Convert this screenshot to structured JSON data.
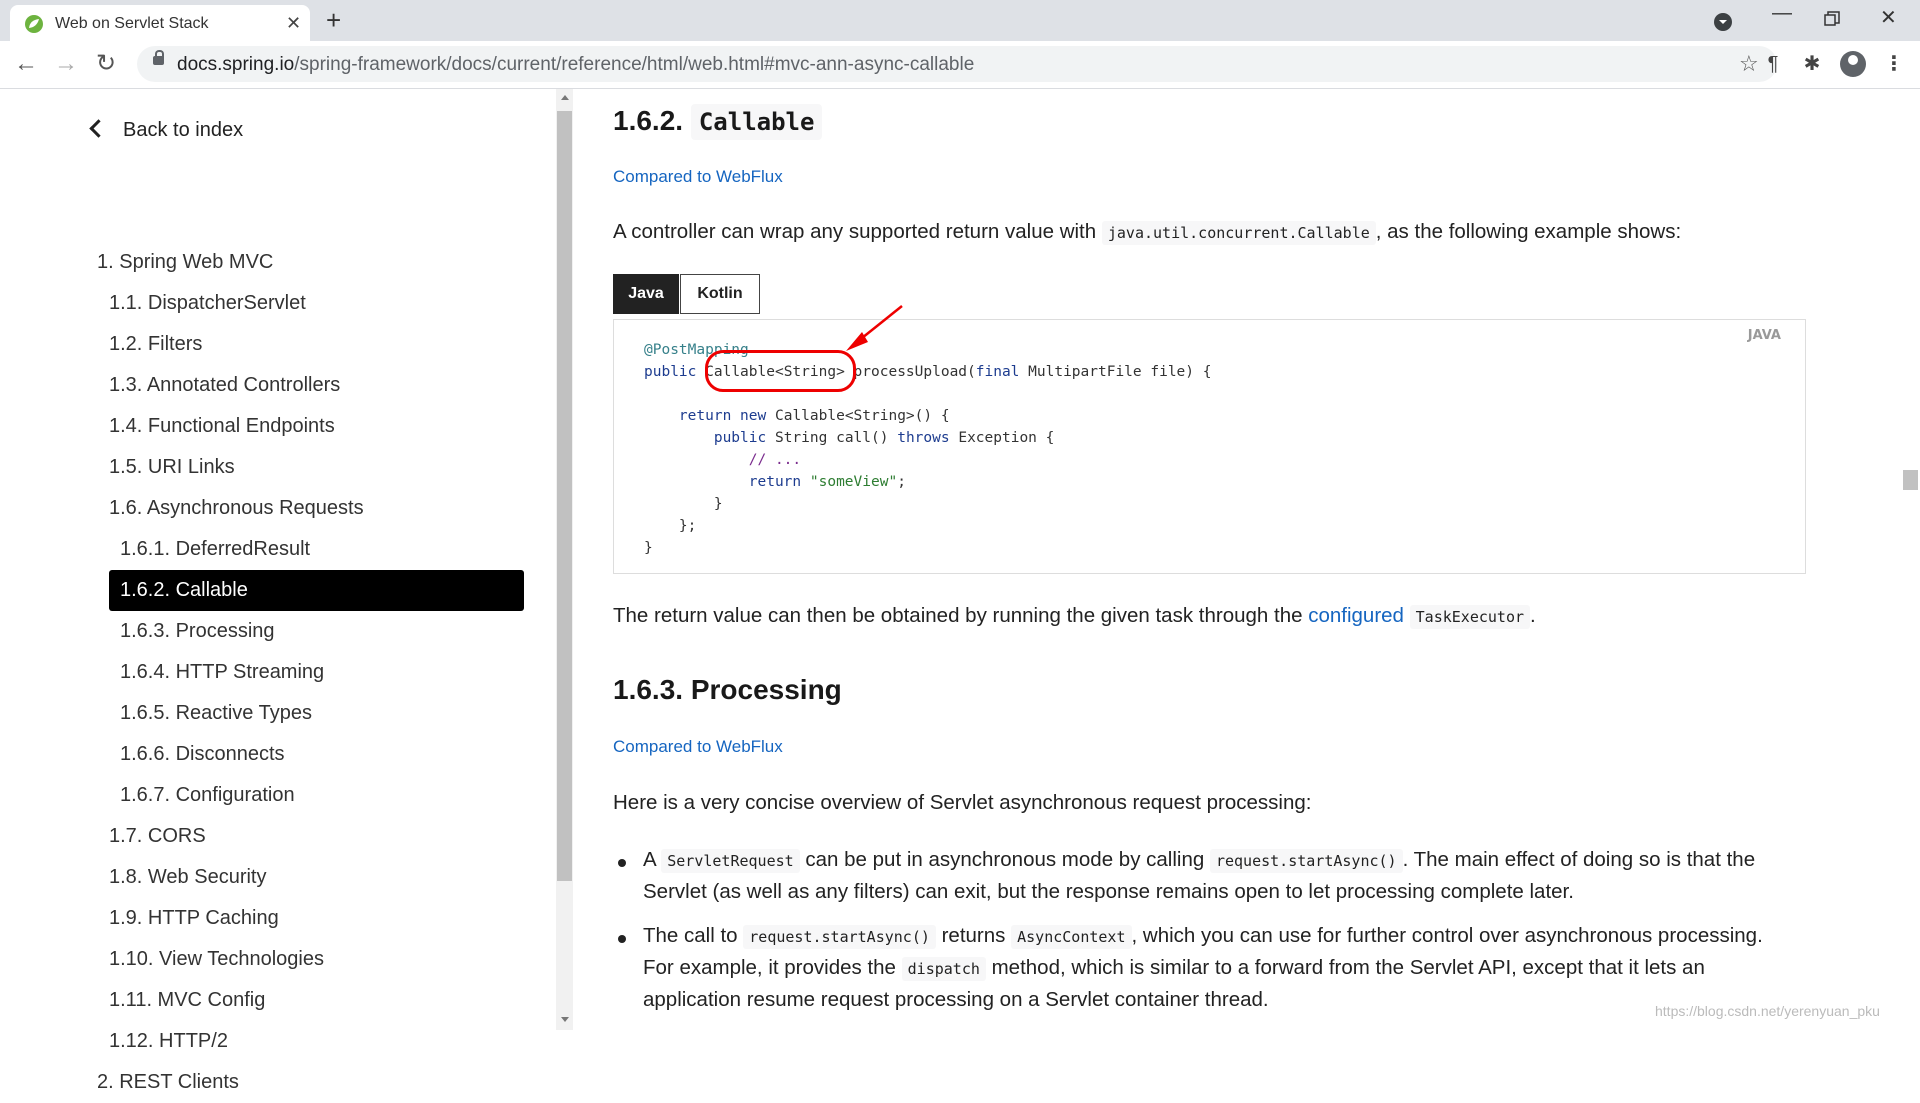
{
  "browser": {
    "tab_title": "Web on Servlet Stack",
    "url_domain": "docs.spring.io",
    "url_path": "/spring-framework/docs/current/reference/html/web.html#mvc-ann-async-callable"
  },
  "sidebar": {
    "back": "Back to index",
    "items": [
      "1. Spring Web MVC",
      "1.1. DispatcherServlet",
      "1.2. Filters",
      "1.3. Annotated Controllers",
      "1.4. Functional Endpoints",
      "1.5. URI Links",
      "1.6. Asynchronous Requests",
      "1.6.1. DeferredResult",
      "1.6.2. Callable",
      "1.6.3. Processing",
      "1.6.4. HTTP Streaming",
      "1.6.5. Reactive Types",
      "1.6.6. Disconnects",
      "1.6.7. Configuration",
      "1.7. CORS",
      "1.8. Web Security",
      "1.9. HTTP Caching",
      "1.10. View Technologies",
      "1.11. MVC Config",
      "1.12. HTTP/2",
      "2. REST Clients"
    ],
    "active_index": 8
  },
  "main": {
    "sec1_num": "1.6.2.",
    "sec1_code": "Callable",
    "compared": "Compared to WebFlux",
    "intro_pre": "A controller can wrap any supported return value with",
    "intro_code": "java.util.concurrent.Callable",
    "intro_post": ", as the following example shows:",
    "tab_java": "Java",
    "tab_kotlin": "Kotlin",
    "code_lang": "JAVA",
    "code": {
      "l1_ann": "@PostMapping",
      "l2_kw": "public",
      "l2_type": "Callable<String>",
      "l2_rest_a": "processUpload(",
      "l2_final": "final",
      "l2_rest_b": "MultipartFile file) {",
      "l4_ret": "return",
      "l4_new": "new",
      "l4_rest": "Callable<String>() {",
      "l5_kw": "public",
      "l5_type": "String",
      "l5_call": "call()",
      "l5_throws": "throws",
      "l5_rest": "Exception {",
      "l6_comment": "// ...",
      "l7_ret": "return",
      "l7_str": "\"someView\"",
      "l7_end": ";",
      "l8": "}",
      "l9": "};",
      "l10": "}"
    },
    "after_pre": "The return value can then be obtained by running the given task through the",
    "after_link": "configured",
    "after_code": "TaskExecutor",
    "after_post": ".",
    "sec2_title": "1.6.3. Processing",
    "overview": "Here is a very concise overview of Servlet asynchronous request processing:",
    "b1_pre": "A",
    "b1_code1": "ServletRequest",
    "b1_mid": "can be put in asynchronous mode by calling",
    "b1_code2": "request.startAsync()",
    "b1_post": ". The main effect of doing so is that the",
    "b1_line2": "Servlet (as well as any filters) can exit, but the response remains open to let processing complete later.",
    "b2_pre": "The call to",
    "b2_code1": "request.startAsync()",
    "b2_mid": "returns",
    "b2_code2": "AsyncContext",
    "b2_post": ", which you can use for further control over asynchronous processing.",
    "b2_l2_pre": "For example, it provides the",
    "b2_l2_code": "dispatch",
    "b2_l2_post": "method, which is similar to a forward from the Servlet API, except that it lets an",
    "b2_l3": "application resume request processing on a Servlet container thread."
  },
  "watermark": "https://blog.csdn.net/yerenyuan_pku"
}
